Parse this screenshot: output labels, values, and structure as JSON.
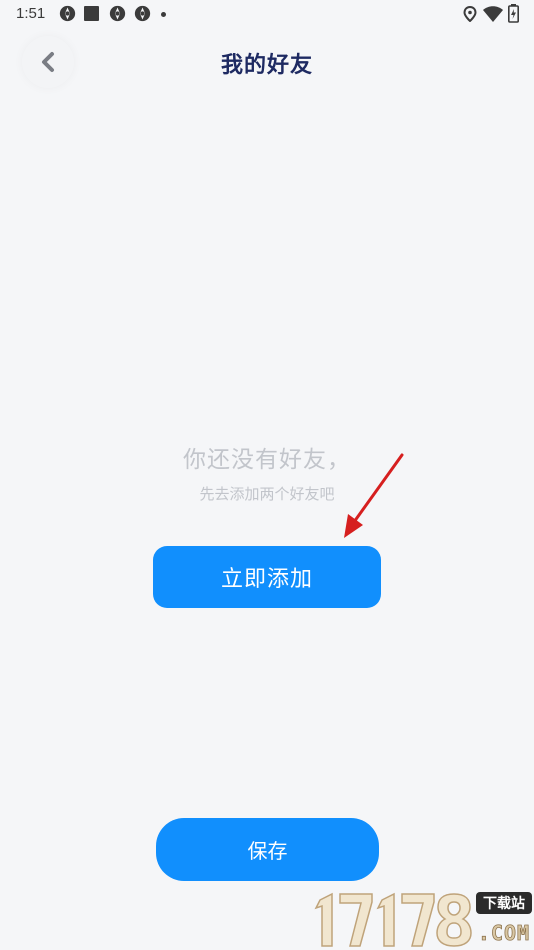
{
  "status_bar": {
    "time": "1:51",
    "left_icons": [
      "aperture-icon",
      "stop-square-icon",
      "aperture-icon",
      "aperture-icon",
      "dot-icon"
    ],
    "right_icons": [
      "location-icon",
      "wifi-icon",
      "battery-icon"
    ]
  },
  "header": {
    "back_icon": "chevron-left-icon",
    "title": "我的好友"
  },
  "empty_state": {
    "title": "你还没有好友，",
    "subtitle": "先去添加两个好友吧",
    "add_button_label": "立即添加"
  },
  "footer": {
    "save_button_label": "保存"
  },
  "watermark": {
    "text": "17178.COM",
    "badge": "下载站"
  },
  "colors": {
    "background": "#f5f6f8",
    "primary": "#118ffd",
    "title": "#1e2a62",
    "muted_text": "#c2c5cb",
    "annotation_arrow": "#d61f1f"
  }
}
